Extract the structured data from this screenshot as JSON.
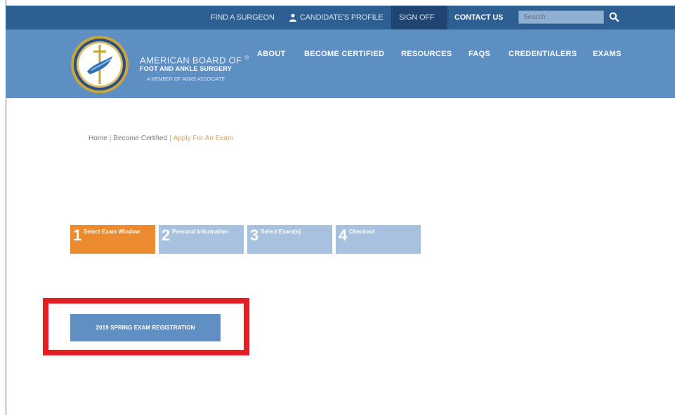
{
  "topbar": {
    "find_surgeon": "FIND A SURGEON",
    "candidate_profile": "CANDIDATE'S PROFILE",
    "sign_off": "SIGN OFF",
    "contact_us": "CONTACT US",
    "search_placeholder": "Search"
  },
  "header": {
    "org_name": "AMERICAN BOARD OF",
    "org_name_reg": "®",
    "org_sub": "FOOT AND ANKLE SURGERY",
    "tagline": "A MEMBER OF ABMS ASSOCIATE",
    "nav": [
      "ABOUT",
      "BECOME CERTIFIED",
      "RESOURCES",
      "FAQS",
      "CREDENTIALERS",
      "EXAMS"
    ]
  },
  "breadcrumb": {
    "home": "Home",
    "become_certified": "Become Certified",
    "current": "Apply For An Exam",
    "separator": "|"
  },
  "steps": [
    {
      "num": "1",
      "label": "Select Exam Window"
    },
    {
      "num": "2",
      "label": "Personal Information"
    },
    {
      "num": "3",
      "label": "Select Exam(s)"
    },
    {
      "num": "4",
      "label": "Checkout"
    }
  ],
  "registration": {
    "button_label": "2019 SPRING EXAM REGISTRATION"
  },
  "colors": {
    "topbar": "#2d5f93",
    "header": "#5e8fc3",
    "step_active": "#eb8a2f",
    "step_inactive": "#a7c1de",
    "highlight": "#e41e25"
  }
}
